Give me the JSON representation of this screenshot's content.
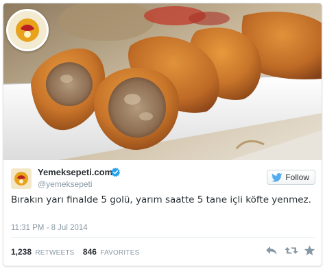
{
  "tweet": {
    "display_name": "Yemeksepeti.com",
    "screen_name": "@yemeksepeti",
    "verified": true,
    "follow_label": "Follow",
    "text": "Bırakın yarı finalde 5 golü, yarım saatte 5 tane içli köfte yenmez.",
    "timestamp": "11:31 PM - 8 Jul 2014",
    "retweets_count": "1,238",
    "retweets_label": "RETWEETS",
    "favorites_count": "846",
    "favorites_label": "FAVORITES"
  },
  "icons": {
    "verified": "verified-badge-icon",
    "follow": "twitter-bird-icon",
    "reply": "reply-icon",
    "retweet": "retweet-icon",
    "favorite": "star-icon"
  },
  "colors": {
    "verified_blue": "#2aa3ef",
    "twitter_blue": "#55acee",
    "action_gray": "#8899a6",
    "text_dark": "#292f33"
  }
}
